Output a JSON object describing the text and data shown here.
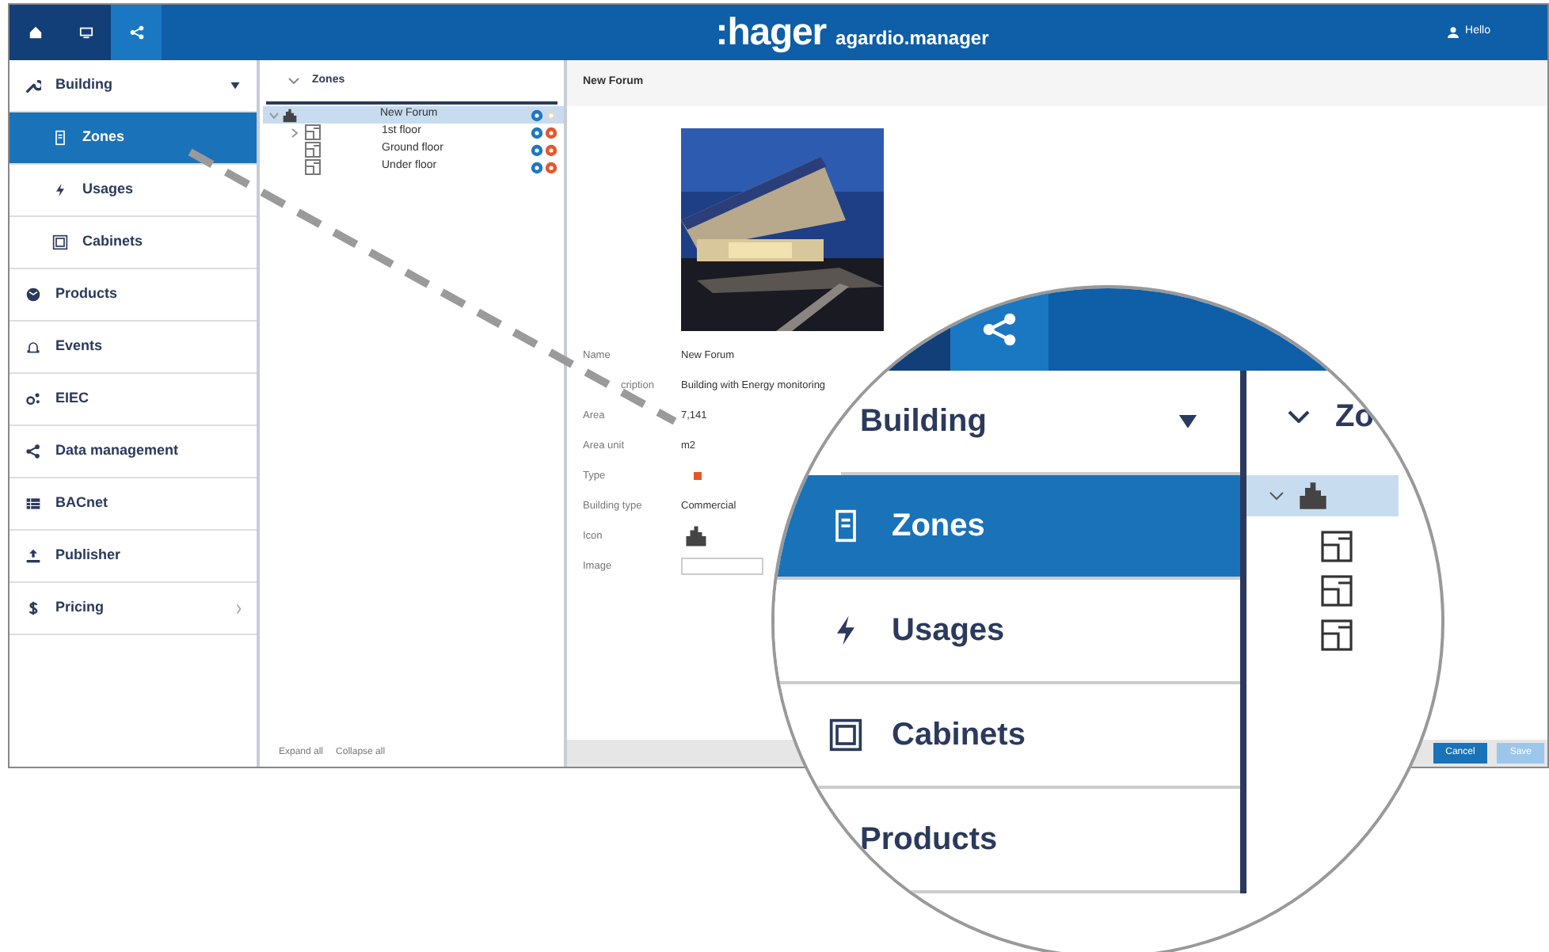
{
  "top_bar": {
    "nav_icons": [
      {
        "selected": false
      },
      {
        "selected": false
      },
      {
        "selected": true
      }
    ],
    "brand": ":hager",
    "product": "agardio.manager",
    "user": "Hello"
  },
  "sidebar": {
    "items": [
      {
        "label": "Building",
        "selected": false,
        "expanded": true,
        "children": [
          {
            "label": "Zones",
            "selected": true
          },
          {
            "label": "Usages",
            "selected": false
          },
          {
            "label": "Cabinets",
            "selected": false
          }
        ]
      },
      {
        "label": "Products",
        "selected": false
      },
      {
        "label": "Events",
        "selected": false
      },
      {
        "label": "EIEC",
        "selected": false
      },
      {
        "label": "Data management",
        "selected": false
      },
      {
        "label": "BACnet",
        "selected": false
      },
      {
        "label": "Publisher",
        "selected": false
      },
      {
        "label": "Pricing",
        "selected": false,
        "expanded": false
      }
    ]
  },
  "tree": {
    "heading": "Zones",
    "nodes": [
      {
        "label": "New Forum",
        "selected": true,
        "expanded": true,
        "deletable": false,
        "children": [
          {
            "label": "1st floor",
            "selected": false,
            "expanded": false,
            "deletable": true
          },
          {
            "label": "Ground floor",
            "selected": false,
            "deletable": true
          },
          {
            "label": "Under floor",
            "selected": false,
            "deletable": true
          }
        ]
      }
    ],
    "footer": [
      "Expand all",
      "Collapse all"
    ]
  },
  "details": {
    "title": "New Forum",
    "fields": [
      {
        "label": "Name",
        "kind": "text",
        "value": "New Forum"
      },
      {
        "label": "cription",
        "clipped": true,
        "kind": "text",
        "value": "Building with Energy monitoring"
      },
      {
        "label": "Area",
        "kind": "text",
        "value": "7,141"
      },
      {
        "label": "Area unit",
        "kind": "text",
        "value": "m2"
      },
      {
        "label": "Type",
        "kind": "badge"
      },
      {
        "label": "Building type",
        "kind": "text",
        "value": "Commercial"
      },
      {
        "label": "Icon",
        "kind": "emblem"
      },
      {
        "label": "Image",
        "kind": "field"
      }
    ],
    "buttons": [
      {
        "label": "Cancel",
        "disabled": false
      },
      {
        "label": "Save",
        "disabled": true
      }
    ]
  },
  "lens": {
    "sidebar_items": [
      {
        "label": "Building",
        "selected": false,
        "expanded": true
      },
      {
        "label": "Zones",
        "selected": true
      },
      {
        "label": "Usages",
        "selected": false
      },
      {
        "label": "Cabinets",
        "selected": false
      },
      {
        "label": "Products",
        "selected": false
      }
    ],
    "tree_heading": "Zo"
  }
}
